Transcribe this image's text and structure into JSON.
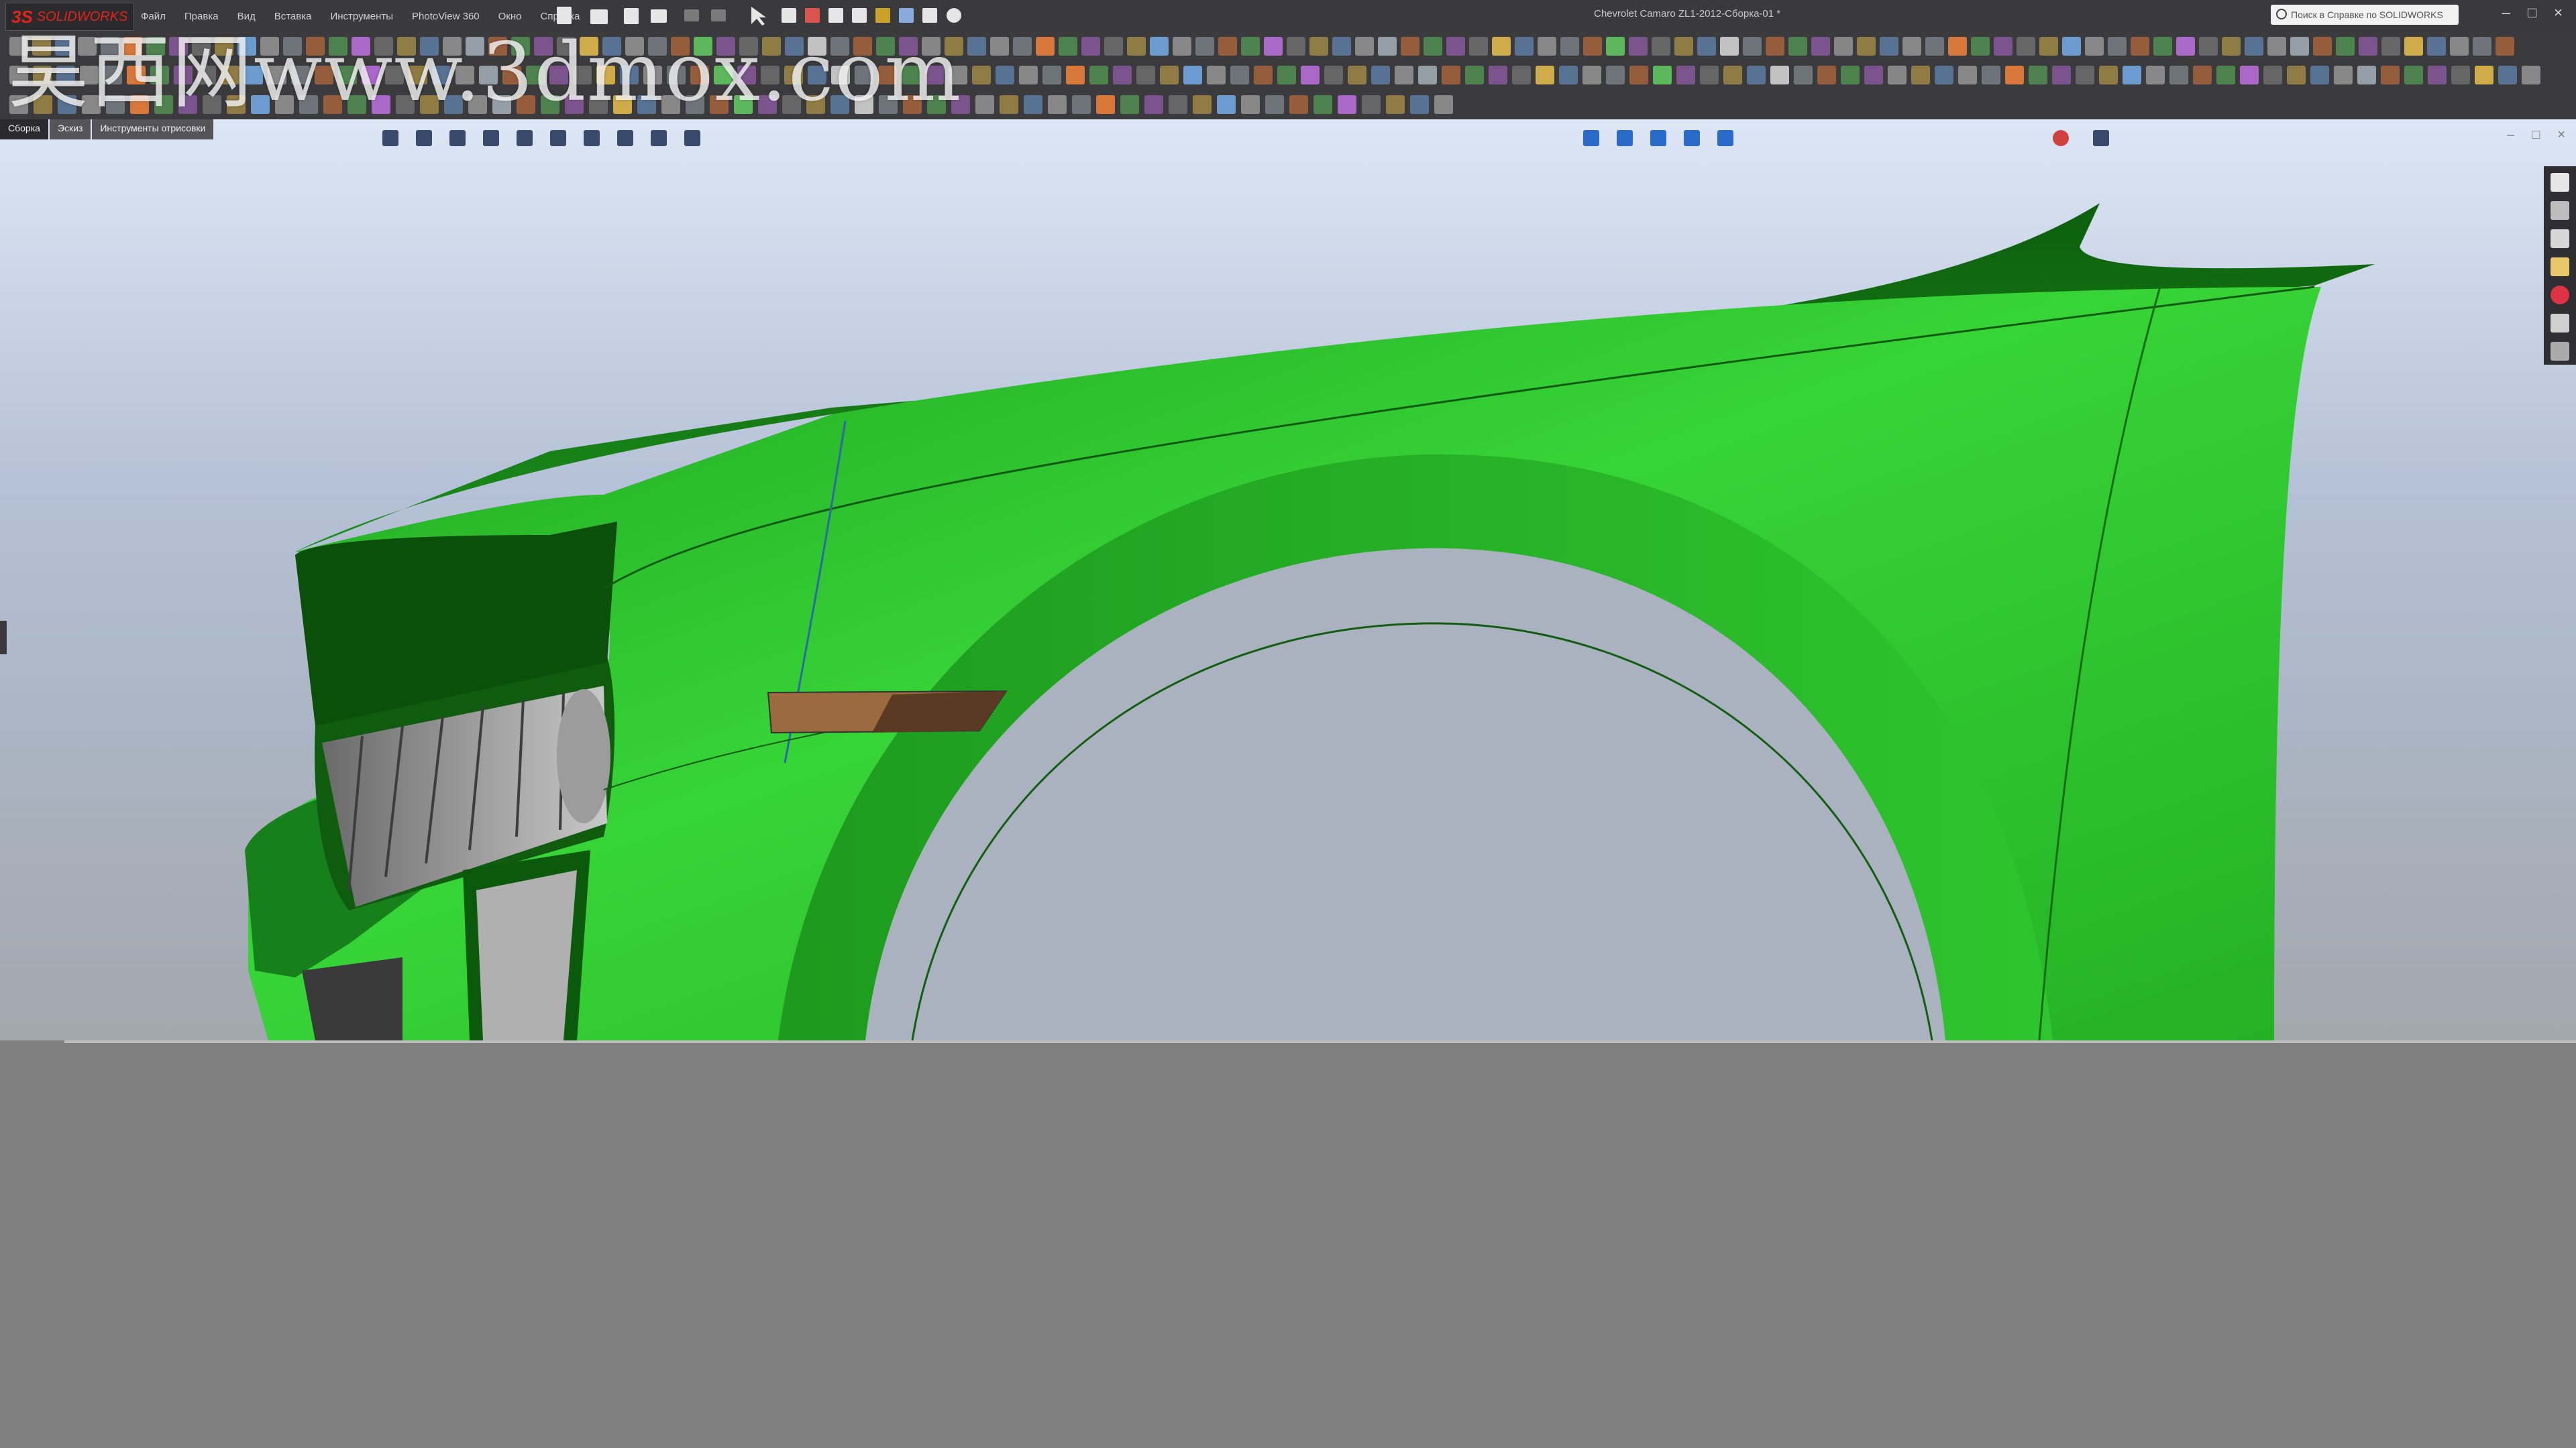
{
  "app": {
    "logo_ds": "3S",
    "logo_name": "SOLIDWORKS",
    "document_title": "Chevrolet Camaro ZL1-2012-Сборка-01 *",
    "help_search_placeholder": "Поиск в Справке по SOLIDWORKS"
  },
  "menu": [
    "Файл",
    "Правка",
    "Вид",
    "Вставка",
    "Инструменты",
    "PhotoView 360",
    "Окно",
    "Справка"
  ],
  "tabs": [
    {
      "label": "Сборка",
      "active": true
    },
    {
      "label": "Эскиз",
      "active": false
    },
    {
      "label": "Инструменты отрисовки",
      "active": false
    }
  ],
  "watermark": "昊西网www.3dmox.com",
  "colors": {
    "ui_dark": "#3a3a3c",
    "panel_grey": "#808080",
    "fender_green": "#2ecc2e",
    "fender_dark": "#0b6e0b"
  },
  "icons": {
    "top_quick": [
      "new-icon",
      "open-icon",
      "save-icon",
      "print-icon",
      "undo-icon",
      "redo-icon",
      "select-icon",
      "rebuild-icon",
      "options-icon"
    ],
    "taskpane": [
      "home-icon",
      "resources-icon",
      "design-library-icon",
      "file-explorer-icon",
      "appearances-icon",
      "custom-properties-icon",
      "forum-icon"
    ],
    "window": [
      "minimize-icon",
      "restore-icon",
      "close-icon"
    ]
  }
}
